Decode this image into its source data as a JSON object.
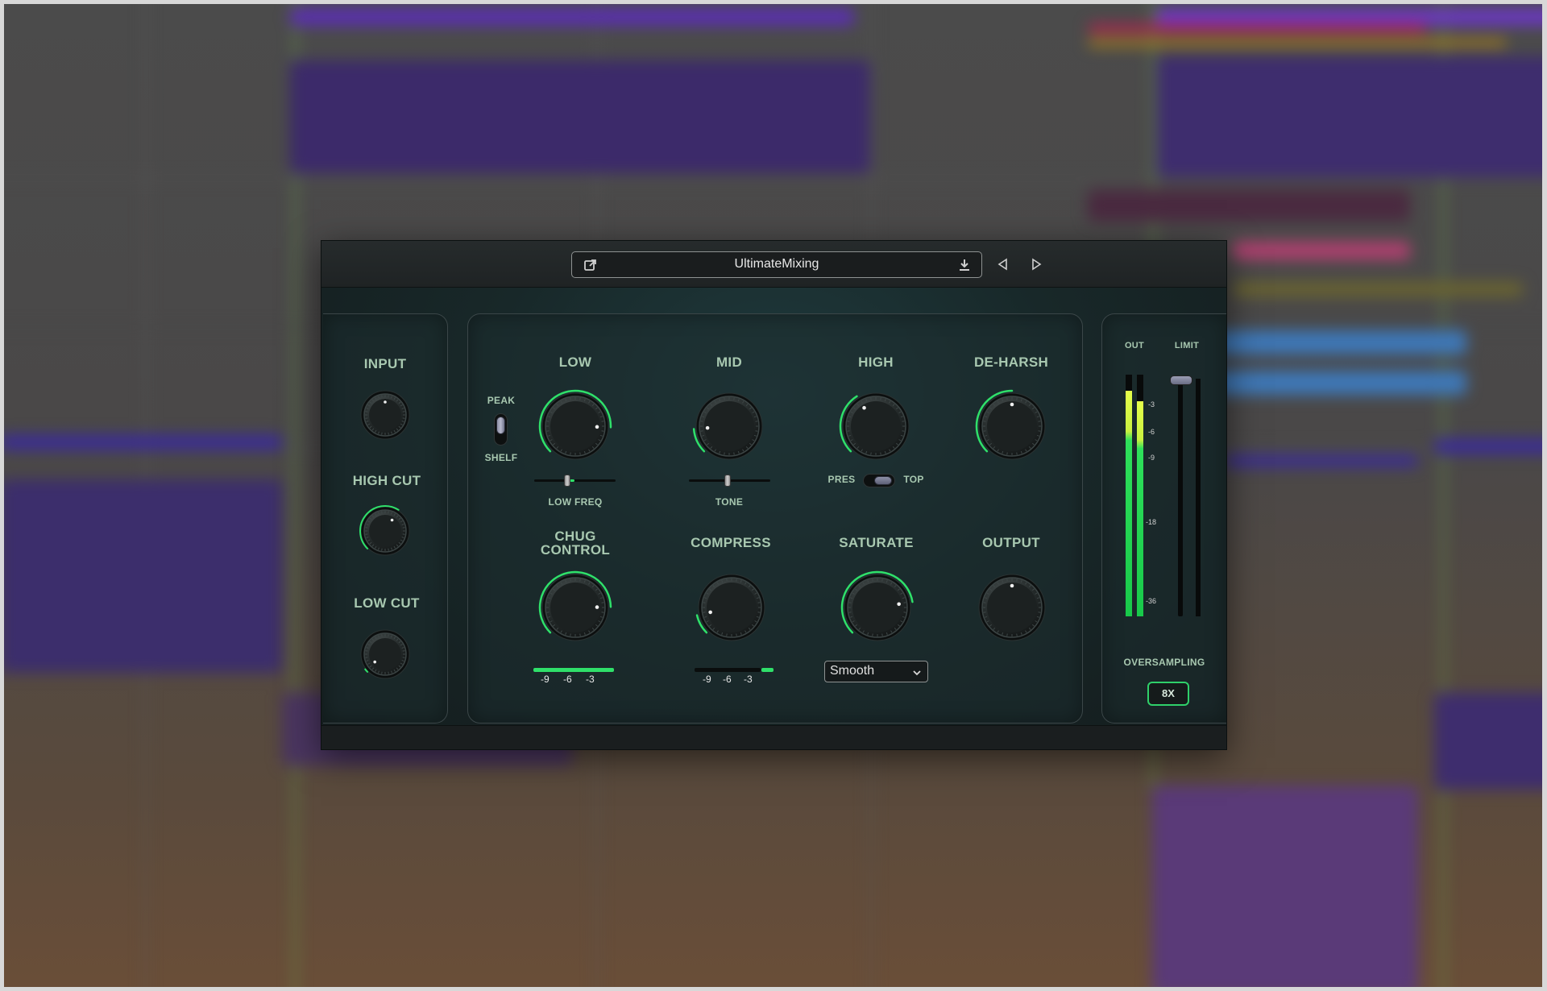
{
  "plugin": {
    "preset_name": "UltimateMixing",
    "left": {
      "input_label": "INPUT",
      "high_cut_label": "HIGH CUT",
      "low_cut_label": "LOW CUT"
    },
    "main": {
      "peak_label": "PEAK",
      "shelf_label": "SHELF",
      "low_label": "LOW",
      "mid_label": "MID",
      "high_label": "HIGH",
      "deharsh_label": "DE-HARSH",
      "low_freq_label": "LOW FREQ",
      "tone_label": "TONE",
      "pres_label": "PRES",
      "top_label": "TOP",
      "chug_label_line1": "CHUG",
      "chug_label_line2": "CONTROL",
      "compress_label": "COMPRESS",
      "saturate_label": "SATURATE",
      "output_label": "OUTPUT",
      "saturate_mode": "Smooth",
      "chug_meter_ticks": [
        "-9",
        "-6",
        "-3"
      ],
      "compress_meter_ticks": [
        "-9",
        "-6",
        "-3"
      ]
    },
    "right": {
      "out_label": "OUT",
      "limit_label": "LIMIT",
      "vu_scale": [
        "-3",
        "-6",
        "-9",
        "-18",
        "-36"
      ],
      "oversampling_label": "OVERSAMPLING",
      "oversampling_value": "8X"
    }
  },
  "icons": {
    "open_external": "open-external-icon",
    "save_preset": "download-icon",
    "prev_preset": "triangle-left-icon",
    "next_preset": "triangle-right-icon",
    "dropdown": "chevron-down-icon"
  },
  "colors": {
    "accent_green": "#2fe06a",
    "label_green": "#a8c8b0",
    "panel_bg": "#182829",
    "meter_yellow": "#e6ff4a"
  }
}
